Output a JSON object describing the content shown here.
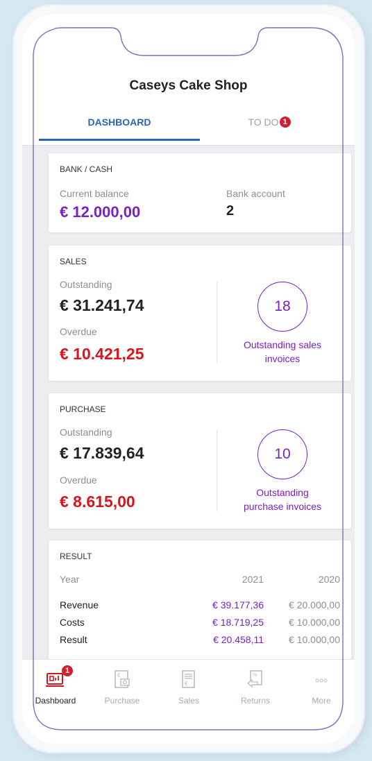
{
  "header": {
    "shop_name": "Caseys Cake Shop",
    "tabs": [
      {
        "label": "DASHBOARD",
        "active": true
      },
      {
        "label": "TO DO",
        "badge": "1"
      }
    ]
  },
  "bank_cash": {
    "title": "BANK / CASH",
    "balance_label": "Current balance",
    "balance_value": "€ 12.000,00",
    "account_label": "Bank account",
    "account_value": "2"
  },
  "sales": {
    "title": "SALES",
    "outstanding_label": "Outstanding",
    "outstanding_value": "€ 31.241,74",
    "overdue_label": "Overdue",
    "overdue_value": "€ 10.421,25",
    "count": "18",
    "count_caption_line1": "Outstanding sales",
    "count_caption_line2": "invoices"
  },
  "purchase": {
    "title": "PURCHASE",
    "outstanding_label": "Outstanding",
    "outstanding_value": "€ 17.839,64",
    "overdue_label": "Overdue",
    "overdue_value": "€ 8.615,00",
    "count": "10",
    "count_caption_line1": "Outstanding",
    "count_caption_line2": "purchase invoices"
  },
  "result": {
    "title": "RESULT",
    "header": {
      "label": "Year",
      "y2021": "2021",
      "y2020": "2020"
    },
    "rows": [
      {
        "label": "Revenue",
        "y2021": "€ 39.177,36",
        "y2020": "€ 20.000,00"
      },
      {
        "label": "Costs",
        "y2021": "€ 18.719,25",
        "y2020": "€ 10.000,00"
      },
      {
        "label": "Result",
        "y2021": "€ 20.458,11",
        "y2020": "€ 10.000,00"
      }
    ]
  },
  "bottom_nav": {
    "items": [
      {
        "label": "Dashboard",
        "icon": "dashboard-icon",
        "badge": "1",
        "active": true
      },
      {
        "label": "Purchase",
        "icon": "purchase-icon"
      },
      {
        "label": "Sales",
        "icon": "sales-icon"
      },
      {
        "label": "Returns",
        "icon": "returns-icon"
      },
      {
        "label": "More",
        "icon": "more-icon"
      }
    ]
  },
  "colors": {
    "accent_blue": "#2a66b2",
    "accent_purple": "#7a1fc5",
    "alert_red": "#d6151f",
    "frame_line": "#7b6fc4"
  }
}
